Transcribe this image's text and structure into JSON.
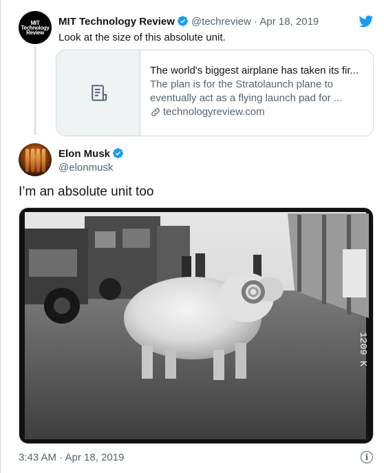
{
  "quoted_tweet": {
    "avatar_text": [
      "MIT",
      "Technology",
      "Review"
    ],
    "name": "MIT Technology Review",
    "handle": "@techreview",
    "separator": "·",
    "date": "Apr 18, 2019",
    "text": "Look at the size of this absolute unit."
  },
  "link_card": {
    "title": "The world's biggest airplane has taken its fir...",
    "description": "The plan is for the Stratolaunch plane to eventually act as a flying launch pad for ...",
    "domain": "technologyreview.com",
    "thumbnail_icon": "document-icon",
    "domain_icon": "link-icon"
  },
  "tweet": {
    "name": "Elon Musk",
    "handle": "@elonmusk",
    "text": "I’m an absolute unit too",
    "photo_caption_mark": "1209 K",
    "timestamp": "3:43 AM · Apr 18, 2019"
  },
  "icons": {
    "brand": "twitter-bird-icon",
    "verified": "verified-badge-icon",
    "info": "info-icon"
  },
  "colors": {
    "twitter_blue": "#1d9bf0",
    "text_primary": "#0f1419",
    "text_secondary": "#536471",
    "border": "#cfd9de"
  }
}
